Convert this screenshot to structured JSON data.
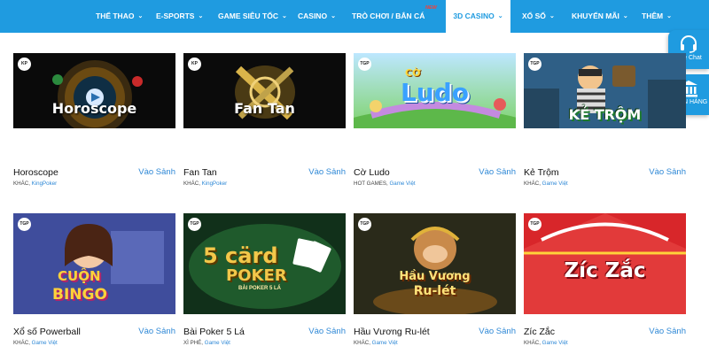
{
  "nav": {
    "items": [
      {
        "label": "THỂ THAO",
        "chevron": true
      },
      {
        "label": "E-SPORTS",
        "chevron": true
      },
      {
        "label": "GAME SIÊU TỐC",
        "chevron": true
      },
      {
        "label": "CASINO",
        "chevron": true
      },
      {
        "label": "TRÒ CHƠI / BẮN CÁ",
        "chevron": false,
        "badge": "NEW"
      },
      {
        "label": "3D CASINO",
        "chevron": true,
        "active": true
      },
      {
        "label": "XỔ SỐ",
        "chevron": true
      },
      {
        "label": "KHUYẾN MÃI",
        "chevron": true
      },
      {
        "label": "THÊM",
        "chevron": true
      }
    ]
  },
  "sidebar": {
    "live_chat": "Live Chat",
    "bank": "NGÂN HÀNG"
  },
  "colors": {
    "nav_bg": "#1f9be0",
    "link": "#2e88d6"
  },
  "games": [
    {
      "name": "Horoscope",
      "tag": "KP",
      "category": "KHÁC",
      "provider": "KingPoker",
      "action": "Vào Sảnh",
      "thumb_text": "Horoscope"
    },
    {
      "name": "Fan Tan",
      "tag": "KP",
      "category": "KHÁC",
      "provider": "KingPoker",
      "action": "Vào Sảnh",
      "thumb_text": "Fan Tan"
    },
    {
      "name": "Cờ Ludo",
      "tag": "TGP",
      "category": "HOT GAMES",
      "provider": "Game Việt",
      "action": "Vào Sảnh",
      "thumb_text_top": "CỜ",
      "thumb_text": "Ludo"
    },
    {
      "name": "Kẻ Trộm",
      "tag": "TGP",
      "category": "KHÁC",
      "provider": "Game Việt",
      "action": "Vào Sảnh",
      "thumb_text": "KẺ TRỘM"
    },
    {
      "name": "Xổ số Powerball",
      "tag": "TGP",
      "category": "KHÁC",
      "provider": "Game Việt",
      "action": "Vào Sảnh",
      "thumb_text_top": "CUỘN",
      "thumb_text": "BINGO"
    },
    {
      "name": "Bài Poker 5 Lá",
      "tag": "TGP",
      "category": "XÌ PHÉ",
      "provider": "Game Việt",
      "action": "Vào Sảnh",
      "thumb_text_top": "5 cärd",
      "thumb_text": "POKER",
      "thumb_text_sub": "BÀI POKER 5 LÁ"
    },
    {
      "name": "Hầu Vương Ru-lét",
      "tag": "TGP",
      "category": "KHÁC",
      "provider": "Game Việt",
      "action": "Vào Sảnh",
      "thumb_text_top": "Hầu Vương",
      "thumb_text": "Ru-lét"
    },
    {
      "name": "Zíc Zắc",
      "tag": "TGP",
      "category": "KHÁC",
      "provider": "Game Việt",
      "action": "Vào Sảnh",
      "thumb_text": "Zíc Zắc"
    }
  ]
}
